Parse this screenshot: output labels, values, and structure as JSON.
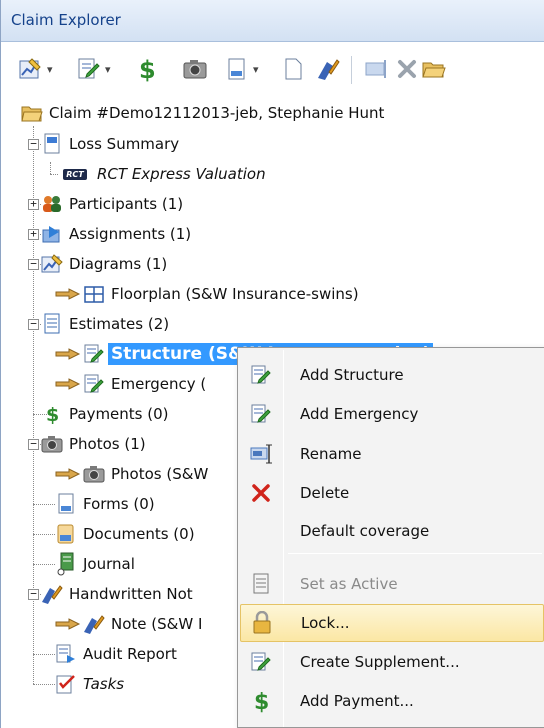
{
  "panel": {
    "title": "Claim Explorer"
  },
  "toolbar": {
    "buttons": [
      {
        "icon": "diagram-icon",
        "has_dropdown": true
      },
      {
        "icon": "estimate-icon",
        "has_dropdown": true
      },
      {
        "icon": "payment-dollar-icon",
        "has_dropdown": false
      },
      {
        "icon": "camera-icon",
        "has_dropdown": false
      },
      {
        "icon": "form-icon",
        "has_dropdown": true
      },
      {
        "icon": "blank-document-icon",
        "has_dropdown": false
      },
      {
        "icon": "handwritten-note-icon",
        "has_dropdown": false
      },
      {
        "icon": "rename-icon",
        "has_dropdown": false
      },
      {
        "icon": "delete-x-icon",
        "has_dropdown": false
      },
      {
        "icon": "claim-folder-icon",
        "has_dropdown": false
      }
    ]
  },
  "tree": {
    "root": "Claim #Demo12112013-jeb, Stephanie Hunt",
    "loss_summary": "Loss Summary",
    "rct_badge": "RCT",
    "rct_valuation": "RCT Express Valuation",
    "participants": "Participants (1)",
    "assignments": "Assignments (1)",
    "diagrams": "Diagrams (1)",
    "floorplan": "Floorplan (S&W Insurance-swins)",
    "estimates": "Estimates (2)",
    "structure": "Structure (S&W Insurance-swins)",
    "emergency": "Emergency (",
    "payments": "Payments (0)",
    "photos_group": "Photos (1)",
    "photos_item": "Photos (S&W",
    "forms": "Forms (0)",
    "documents": "Documents (0)",
    "journal": "Journal",
    "handwritten": "Handwritten Not",
    "note": "Note (S&W I",
    "audit": "Audit Report",
    "tasks": "Tasks"
  },
  "context_menu": {
    "items": [
      {
        "label": "Add Structure",
        "icon": "add-estimate-icon",
        "enabled": true
      },
      {
        "label": "Add Emergency",
        "icon": "add-estimate-icon",
        "enabled": true
      },
      {
        "label": "Rename",
        "icon": "rename-icon",
        "enabled": true
      },
      {
        "label": "Delete",
        "icon": "delete-x-icon",
        "enabled": true
      },
      {
        "label": "Default coverage",
        "icon": "",
        "enabled": true
      },
      {
        "label": "Set as Active",
        "icon": "document-icon",
        "enabled": false
      },
      {
        "label": "Lock...",
        "icon": "lock-icon",
        "enabled": true,
        "highlighted": true
      },
      {
        "label": "Create Supplement...",
        "icon": "supplement-icon",
        "enabled": true
      },
      {
        "label": "Add Payment...",
        "icon": "dollar-icon",
        "enabled": true
      }
    ]
  },
  "colors": {
    "selection": "#3399ff",
    "title_text": "#15428b",
    "menu_highlight": "#fbe7a4",
    "delete_red": "#d0241b",
    "dollar_green": "#2e8b2e"
  }
}
